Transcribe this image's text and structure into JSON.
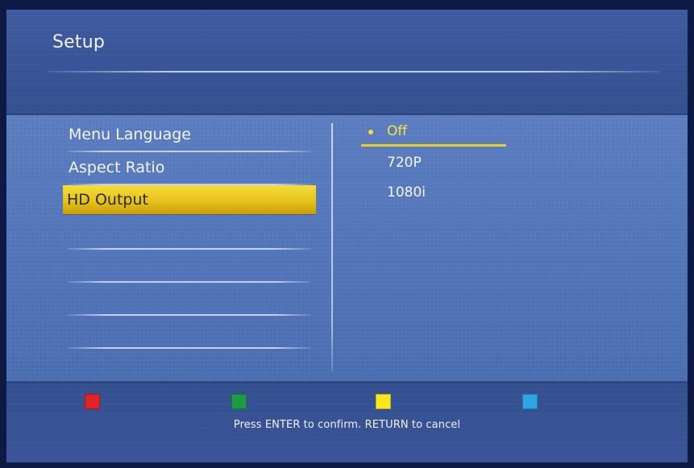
{
  "header": {
    "title": "Setup"
  },
  "menu": {
    "items": [
      {
        "label": "Menu Language"
      },
      {
        "label": "Aspect Ratio"
      },
      {
        "label": "HD Output",
        "selected": true
      }
    ]
  },
  "options": {
    "items": [
      {
        "label": "Off",
        "active": true
      },
      {
        "label": "720P"
      },
      {
        "label": "1080i"
      }
    ]
  },
  "footer": {
    "hint": "Press ENTER to confirm. RETURN to cancel",
    "keys": [
      {
        "name": "red",
        "color": "#e0232a"
      },
      {
        "name": "green",
        "color": "#1f9a45"
      },
      {
        "name": "yellow",
        "color": "#f7e81a"
      },
      {
        "name": "blue",
        "color": "#2ea6e6"
      }
    ]
  },
  "colors": {
    "highlight": "#f6dc3a",
    "active_option": "#f6e33b"
  }
}
